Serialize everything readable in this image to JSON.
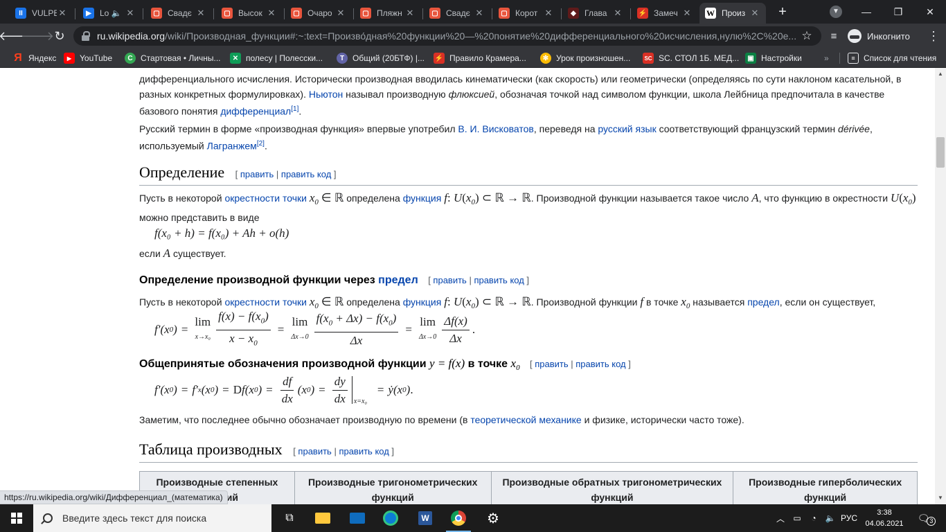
{
  "tabs": [
    {
      "label": "VULPE",
      "icon": "vulpes-icon",
      "color": "#1a73e8"
    },
    {
      "label": "Lo",
      "icon": "video-icon",
      "color": "#1a73e8"
    },
    {
      "label": "Свадє",
      "icon": "video-site-icon",
      "color": "#e8553d"
    },
    {
      "label": "Высок",
      "icon": "video-site-icon",
      "color": "#e8553d"
    },
    {
      "label": "Очаро",
      "icon": "video-site-icon",
      "color": "#e8553d"
    },
    {
      "label": "Пляжн",
      "icon": "video-site-icon",
      "color": "#e8553d"
    },
    {
      "label": "Свадє",
      "icon": "video-site-icon",
      "color": "#e8553d"
    },
    {
      "label": "Корот",
      "icon": "video-site-icon",
      "color": "#e8553d"
    },
    {
      "label": "Глава",
      "icon": "book-icon",
      "color": "#5f1a1a"
    },
    {
      "label": "Замеч",
      "icon": "bolt-icon",
      "color": "#d93025"
    },
    {
      "label": "Произ",
      "icon": "wikipedia-icon",
      "color": "#ffffff"
    }
  ],
  "toolbar": {
    "url_host": "ru.wikipedia.org",
    "url_rest": "/wiki/Производная_функции#:~:text=Произво́дная%20функции%20—%20понятие%20дифференциального%20исчисления,нулю%2C%20е...",
    "incognito_label": "Инкогнито"
  },
  "bookmarks": [
    {
      "label": "Яндекс",
      "icon": "yandex-icon",
      "color": "#fc3f1d"
    },
    {
      "label": "YouTube",
      "icon": "youtube-icon",
      "color": "#ff0000"
    },
    {
      "label": "Стартовая • Личны...",
      "icon": "start-icon",
      "color": "#34a853"
    },
    {
      "label": "полесу | Полесски...",
      "icon": "polesu-icon",
      "color": "#0f9d58"
    },
    {
      "label": "Общий (20БТФ) |...",
      "icon": "teams-icon",
      "color": "#6264a7"
    },
    {
      "label": "Правило Крамера...",
      "icon": "bolt-icon",
      "color": "#d93025"
    },
    {
      "label": "Урок произношен...",
      "icon": "pinwheel-icon",
      "color": "#fbbc05"
    },
    {
      "label": "SC. СТОЛ 1Б. МЕД...",
      "icon": "sc-icon",
      "color": "#d93025"
    },
    {
      "label": "Настройки",
      "icon": "settings-page-icon",
      "color": "#0b8043"
    }
  ],
  "reading_list_label": "Список для чтения",
  "article": {
    "intro1_a": "дифференциального исчисления. Исторически производная вводилась кинематически (как скорость) или геометрически (определяясь по сути наклоном касательной, в разных конкретных формулировках). ",
    "intro1_link_newton": "Ньютон",
    "intro1_b": " называл производную ",
    "intro1_fluxion": "флюксией",
    "intro1_c": ", обозначая точкой над символом функции, школа Лейбница предпочитала в качестве базового понятия ",
    "intro1_link_diff": "дифференциал",
    "intro1_ref": "[1]",
    "intro2_a": "Русский термин в форме «производная функция» впервые употребил ",
    "intro2_link_viskovatov": "В. И. Висковатов",
    "intro2_b": ", переведя на ",
    "intro2_link_russian": "русский язык",
    "intro2_c": " соответствующий французский термин ",
    "intro2_derivee": "dérivée",
    "intro2_d": ", используемый ",
    "intro2_link_lagrange": "Лагранжем",
    "intro2_ref": "[2]",
    "edit_open": "[ ",
    "edit_link": "править",
    "edit_sep": " | ",
    "edit_code": "править код",
    "edit_close": " ]",
    "h2_definition": "Определение",
    "def_p1_a": "Пусть в некоторой ",
    "def_p1_link_nbhd": "окрестности точки",
    "def_p1_b": " определена ",
    "def_p1_link_func": "функция",
    "def_p1_c": ". Производной функции называется такое число ",
    "def_p1_d": ", что функцию в окрестности ",
    "def_p1_e": " можно представить в виде",
    "def_formula": "f(x₀ + h) = f(x₀) + Ah + o(h)",
    "def_p2": "если",
    "def_p2_b": " существует.",
    "h3_limit_a": "Определение производной функции через ",
    "h3_limit_link": "предел",
    "lim_p_a": "Пусть в некоторой ",
    "lim_p_link_nbhd": "окрестности точки",
    "lim_p_b": " определена ",
    "lim_p_link_func": "функция",
    "lim_p_c": ". Производной функции ",
    "lim_p_d": " в точке ",
    "lim_p_e": " называется ",
    "lim_p_link_limit": "предел",
    "lim_p_f": ", если он существует,",
    "h3_notation_a": "Общепринятые обозначения производной функции ",
    "h3_notation_b": " в точке ",
    "note_p_a": "Заметим, что последнее обычно обозначает производную по времени (в ",
    "note_p_link": "теоретической механике",
    "note_p_b": " и физике, исторически часто тоже).",
    "h2_table": "Таблица производных",
    "table_headers": [
      "Производные степенных функций",
      "Производные тригонометрических функций",
      "Производные обратных тригонометрических функций",
      "Производные гиперболических функций"
    ]
  },
  "status_url": "https://ru.wikipedia.org/wiki/Дифференциал_(математика)",
  "taskbar": {
    "search_placeholder": "Введите здесь текст для поиска",
    "lang": "РУС",
    "time": "3:38",
    "date": "04.06.2021",
    "notifications": "3"
  }
}
